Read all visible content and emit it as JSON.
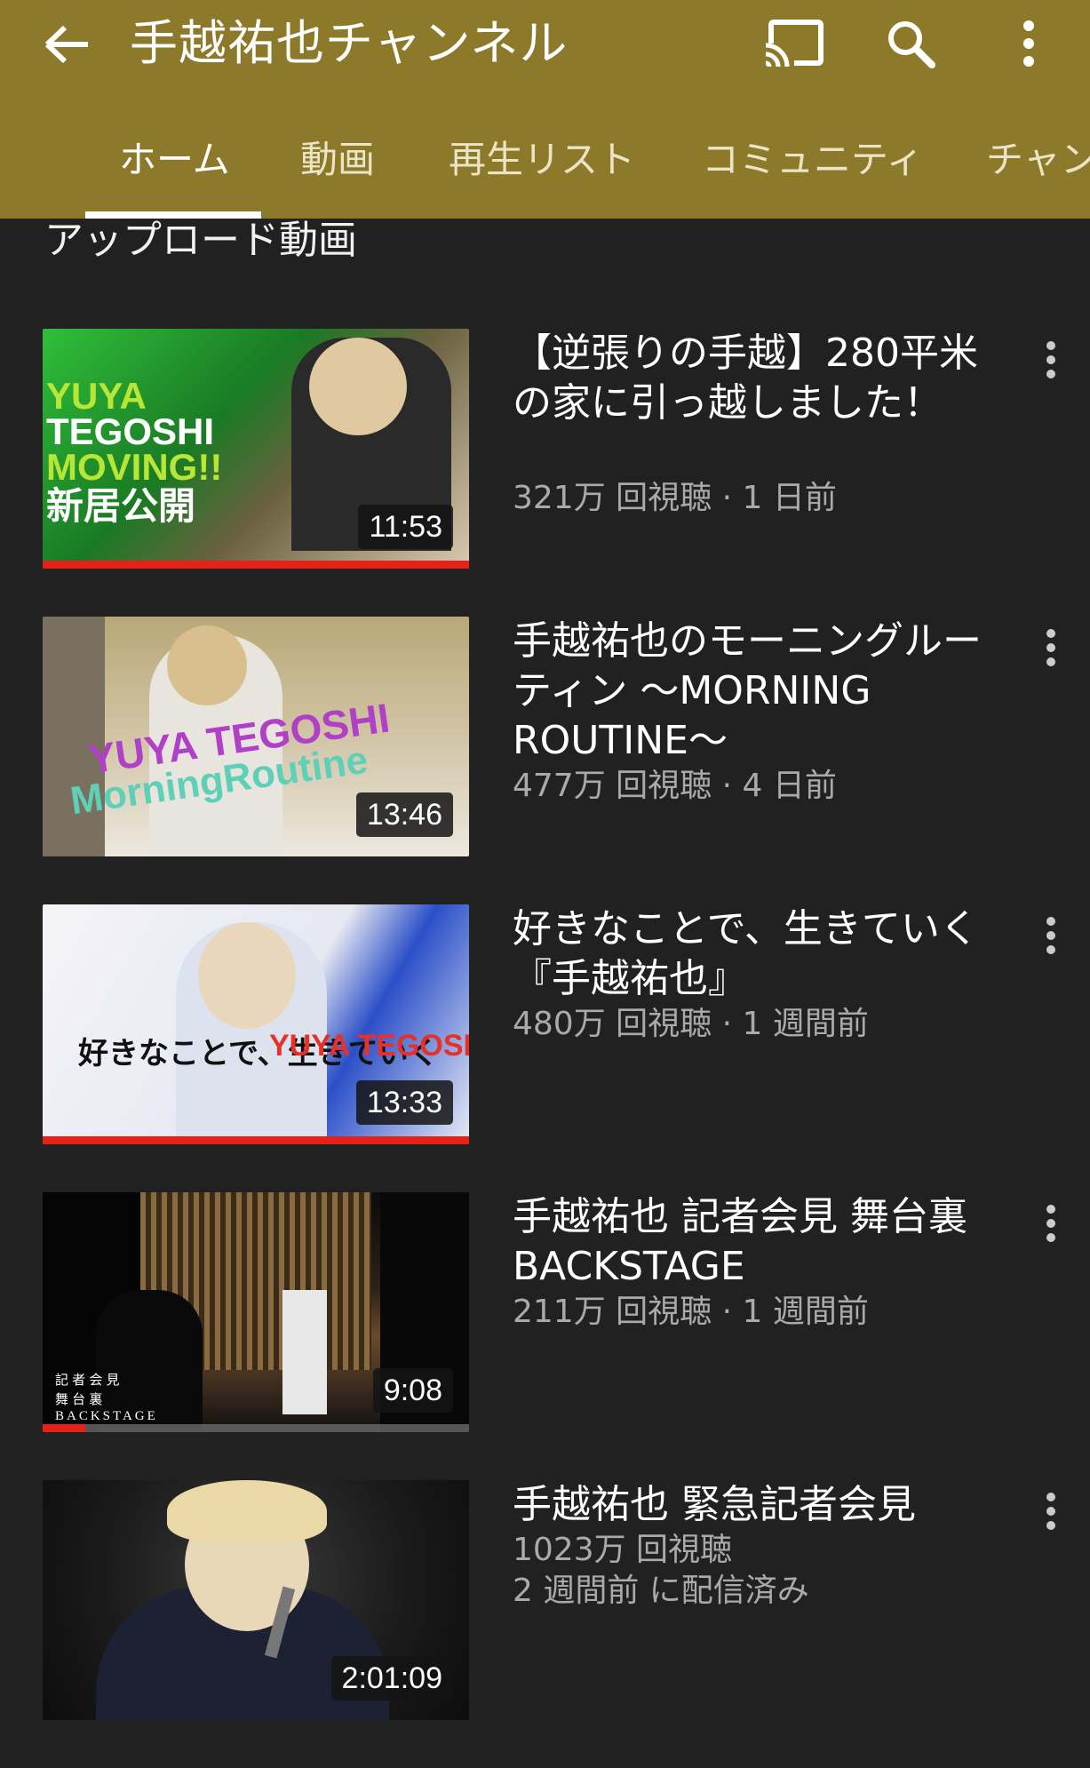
{
  "header": {
    "channel_title": "手越祐也チャンネル",
    "icons": [
      "back-arrow-icon",
      "cast-icon",
      "search-icon",
      "more-vert-icon"
    ],
    "background_color": "#8c7a2a"
  },
  "tabs": [
    {
      "label": "ホーム",
      "active": true
    },
    {
      "label": "動画",
      "active": false
    },
    {
      "label": "再生リスト",
      "active": false
    },
    {
      "label": "コミュニティ",
      "active": false
    },
    {
      "label": "チャン",
      "active": false
    }
  ],
  "section": {
    "title": "アップロード動画"
  },
  "videos": [
    {
      "title": "【逆張りの手越】280平米の家に引っ越しました！",
      "views": "321万 回視聴",
      "age": "1 日前",
      "duration": "11:53",
      "watched_fraction": 1.0,
      "thumb_text": [
        "YUYA",
        "TEGOSHI",
        "MOVING!!",
        "新居公開"
      ]
    },
    {
      "title": "手越祐也のモーニングルーティン ～MORNING ROUTINE～",
      "views": "477万 回視聴",
      "age": "4 日前",
      "duration": "13:46",
      "watched_fraction": 0,
      "thumb_text": [
        "YUYA TEGOSHI",
        "MorningRoutine"
      ]
    },
    {
      "title": "好きなことで、生きていく『手越祐也』",
      "views": "480万 回視聴",
      "age": "1 週間前",
      "duration": "13:33",
      "watched_fraction": 1.0,
      "thumb_text": [
        "好きなことで、生きていく",
        "YUYA TEGOSHI"
      ]
    },
    {
      "title": "手越祐也 記者会見 舞台裏 BACKSTAGE",
      "views": "211万 回視聴",
      "age": "1 週間前",
      "duration": "9:08",
      "watched_fraction": 0.1,
      "thumb_text": [
        "記 者 会 見",
        "舞 台 裏",
        "BACKSTAGE"
      ]
    },
    {
      "title": "手越祐也 緊急記者会見",
      "views": "1023万 回視聴",
      "age": "2 週間前 に配信済み",
      "duration": "2:01:09",
      "watched_fraction": 0,
      "thumb_text": []
    }
  ]
}
